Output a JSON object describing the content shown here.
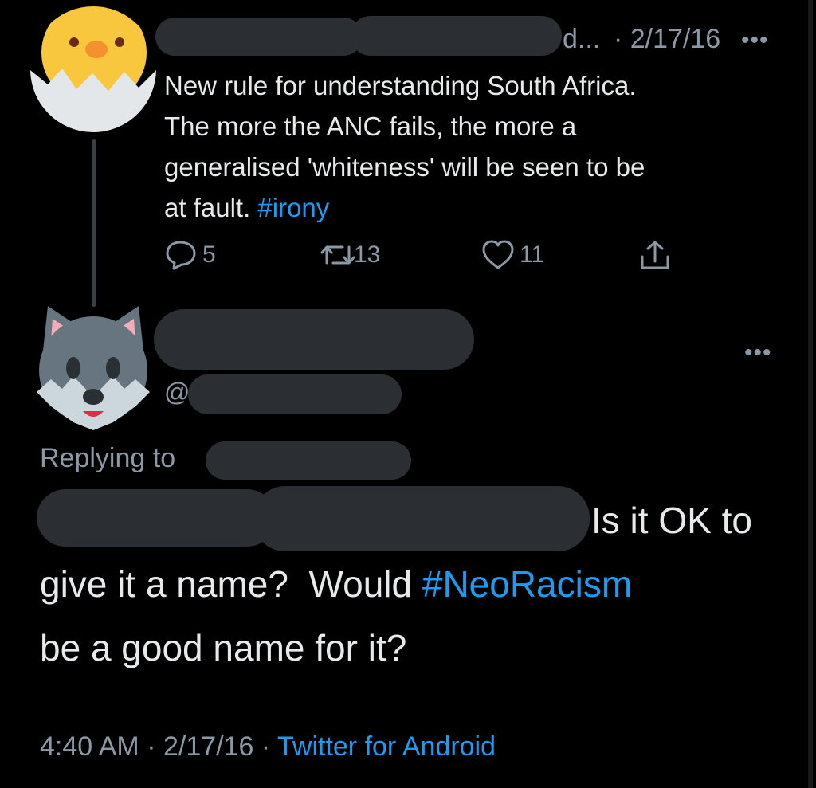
{
  "original_tweet": {
    "name_tail": "d...",
    "date": "· 2/17/16",
    "more": "•••",
    "text_lines": [
      "New rule for understanding South Africa.",
      "The more the ANC fails, the more a",
      "generalised 'whiteness' will be seen to be",
      "at fault."
    ],
    "hashtag": "#irony",
    "actions": {
      "replies": "5",
      "retweets": "13",
      "likes": "11"
    }
  },
  "reply_tweet": {
    "handle_prefix": "@",
    "more": "•••",
    "replying_to_label": "Replying to",
    "text_part1": "Is it OK to",
    "text_part2": "give it a name?  Would ",
    "hashtag": "#NeoRacism",
    "text_part3": "be a good name for it?",
    "time": "4:40 AM · 2/17/16 · ",
    "source": "Twitter for Android"
  },
  "colors": {
    "background": "#000000",
    "text": "#e7e9ea",
    "muted": "#8b98a5",
    "link": "#1d9bf0",
    "redaction": "#2b2f33"
  }
}
